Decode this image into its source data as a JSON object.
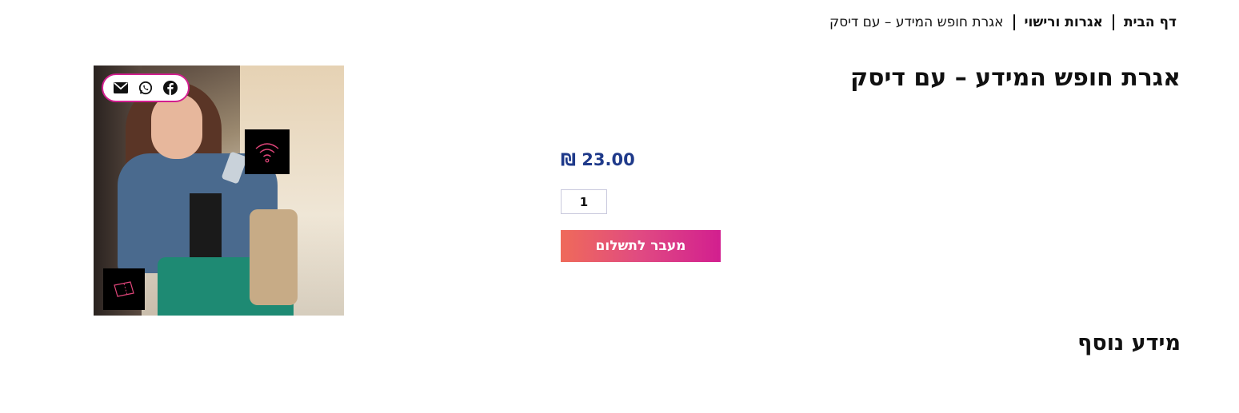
{
  "breadcrumb": {
    "home": "דף הבית",
    "category": "אגרות ורישוי",
    "current": "אגרת חופש המידע – עם דיסק"
  },
  "product": {
    "title": "אגרת חופש המידע – עם דיסק",
    "price": "₪ 23.00",
    "quantity": "1",
    "checkout_label": "מעבר לתשלום",
    "image_alt": "woman-smiling-with-phone",
    "share": {
      "icons": [
        "email-icon",
        "whatsapp-icon",
        "facebook-icon"
      ]
    }
  },
  "additional_info": {
    "title": "מידע נוסף"
  },
  "colors": {
    "accent_gradient_start": "#ef6a5a",
    "accent_gradient_end": "#d21f8f",
    "price_color": "#1f3a8a"
  }
}
